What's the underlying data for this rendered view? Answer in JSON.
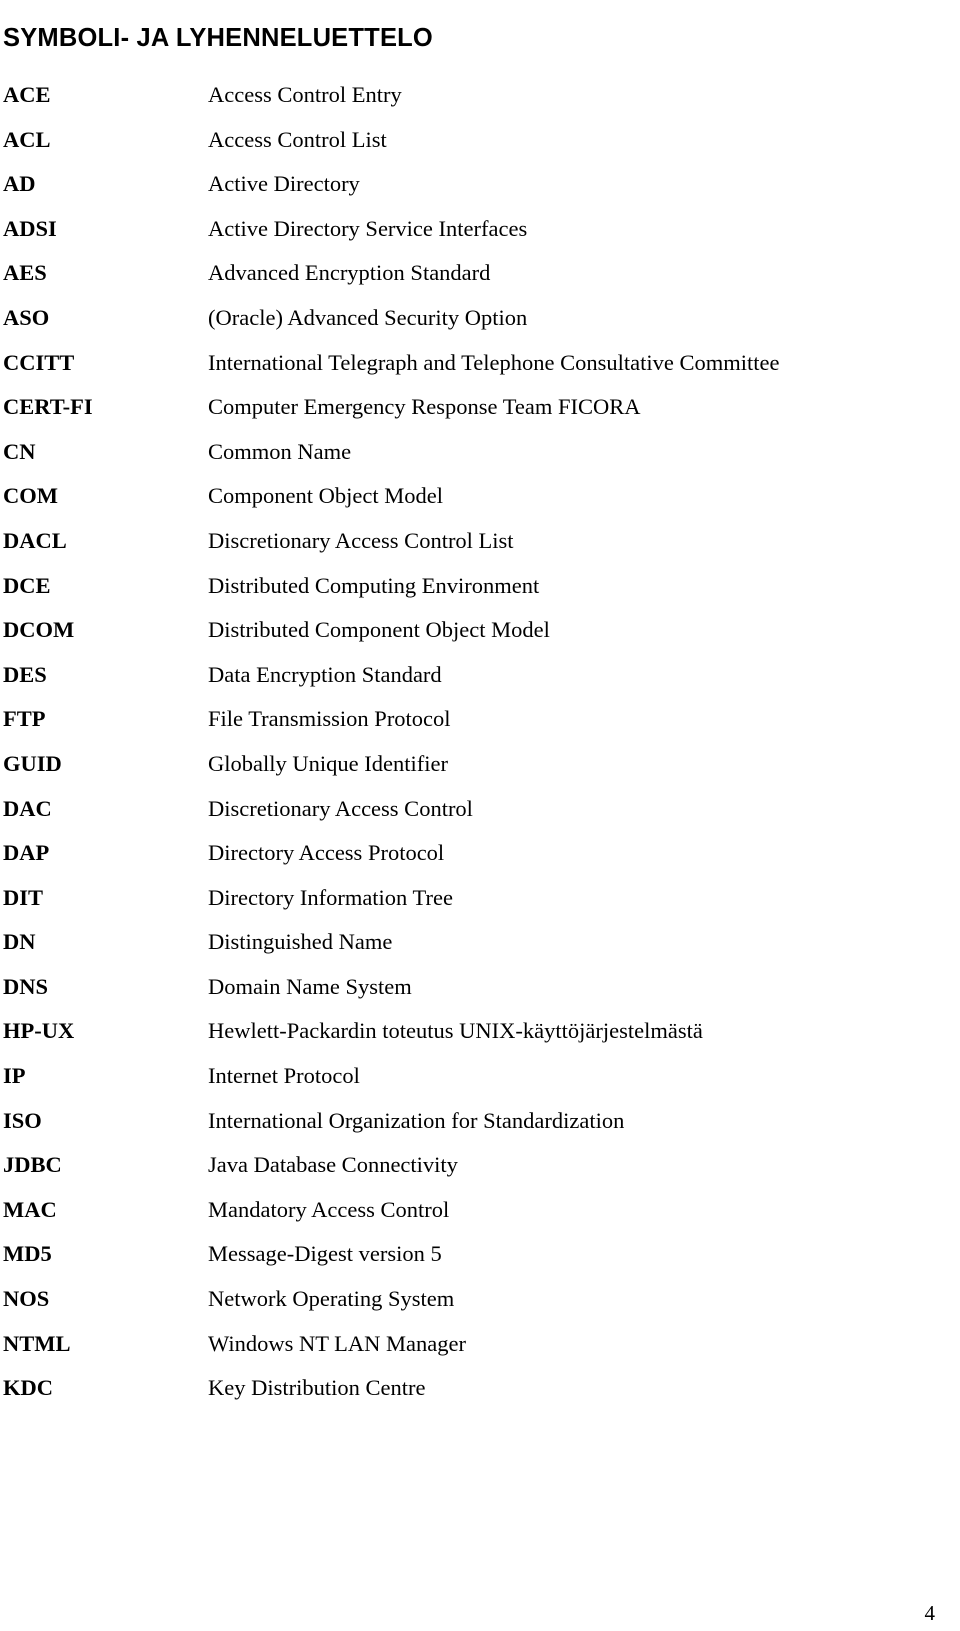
{
  "document": {
    "heading": "SYMBOLI- JA LYHENNELUETTELO",
    "page_number": "4",
    "text_color": "#000000",
    "background_color": "#ffffff"
  },
  "abbreviations": [
    {
      "term": "ACE",
      "definition": "Access Control Entry"
    },
    {
      "term": "ACL",
      "definition": "Access Control List"
    },
    {
      "term": "AD",
      "definition": "Active Directory"
    },
    {
      "term": "ADSI",
      "definition": "Active Directory Service Interfaces"
    },
    {
      "term": "AES",
      "definition": "Advanced Encryption Standard"
    },
    {
      "term": "ASO",
      "definition": "(Oracle) Advanced Security Option"
    },
    {
      "term": "CCITT",
      "definition": "International Telegraph and Telephone Consultative Committee"
    },
    {
      "term": "CERT-FI",
      "definition": "Computer Emergency Response Team FICORA"
    },
    {
      "term": "CN",
      "definition": "Common Name"
    },
    {
      "term": "COM",
      "definition": "Component Object Model"
    },
    {
      "term": "DACL",
      "definition": "Discretionary Access Control List"
    },
    {
      "term": "DCE",
      "definition": "Distributed Computing Environment"
    },
    {
      "term": "DCOM",
      "definition": "Distributed Component Object Model"
    },
    {
      "term": "DES",
      "definition": "Data Encryption Standard"
    },
    {
      "term": "FTP",
      "definition": "File Transmission Protocol"
    },
    {
      "term": "GUID",
      "definition": "Globally Unique Identifier"
    },
    {
      "term": "DAC",
      "definition": "Discretionary Access Control"
    },
    {
      "term": "DAP",
      "definition": "Directory Access Protocol"
    },
    {
      "term": "DIT",
      "definition": "Directory Information Tree"
    },
    {
      "term": "DN",
      "definition": "Distinguished Name"
    },
    {
      "term": "DNS",
      "definition": "Domain Name System"
    },
    {
      "term": "HP-UX",
      "definition": "Hewlett-Packardin toteutus UNIX-käyttöjärjestelmästä"
    },
    {
      "term": "IP",
      "definition": "Internet Protocol"
    },
    {
      "term": "ISO",
      "definition": "International Organization for Standardization"
    },
    {
      "term": "JDBC",
      "definition": "Java Database Connectivity"
    },
    {
      "term": "MAC",
      "definition": "Mandatory Access Control"
    },
    {
      "term": "MD5",
      "definition": "Message-Digest version 5"
    },
    {
      "term": "NOS",
      "definition": "Network Operating System"
    },
    {
      "term": "NTML",
      "definition": "Windows NT LAN Manager"
    },
    {
      "term": "KDC",
      "definition": "Key Distribution Centre"
    }
  ]
}
